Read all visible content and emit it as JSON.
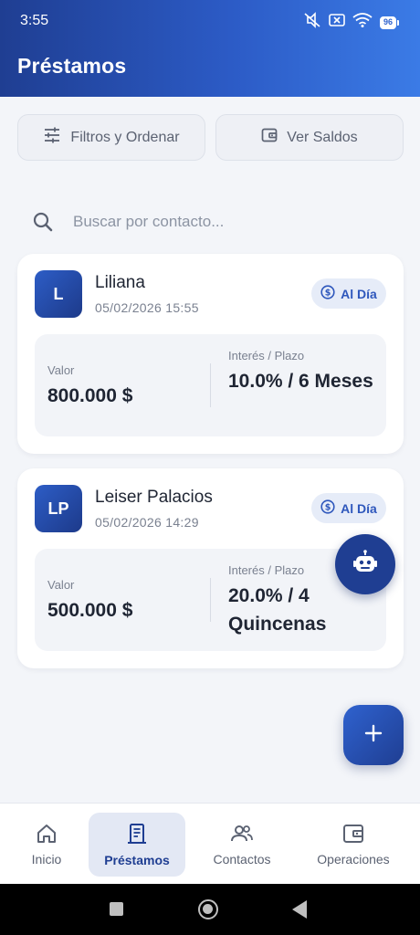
{
  "status_bar": {
    "time": "3:55",
    "battery": "96"
  },
  "header": {
    "title": "Préstamos"
  },
  "actions": {
    "filters_label": "Filtros y Ordenar",
    "balances_label": "Ver Saldos"
  },
  "search": {
    "placeholder": "Buscar por contacto..."
  },
  "loans": [
    {
      "initials": "L",
      "name": "Liliana",
      "datetime": "05/02/2026 15:55",
      "status": "Al Día",
      "valor_label": "Valor",
      "valor": "800.000 $",
      "interes_label": "Interés / Plazo",
      "interes": "10.0% / 6 Meses"
    },
    {
      "initials": "LP",
      "name": "Leiser Palacios",
      "datetime": "05/02/2026 14:29",
      "status": "Al Día",
      "valor_label": "Valor",
      "valor": "500.000 $",
      "interes_label": "Interés / Plazo",
      "interes": "20.0% / 4 Quincenas"
    }
  ],
  "nav": {
    "inicio": "Inicio",
    "prestamos": "Préstamos",
    "contactos": "Contactos",
    "operaciones": "Operaciones"
  },
  "colors": {
    "primary": "#1f3e92",
    "accent": "#3b7be6",
    "badge_bg": "#e6ecf8"
  },
  "icons": [
    "mute-icon",
    "sim-icon",
    "wifi-icon",
    "battery-icon",
    "sliders-icon",
    "wallet-icon",
    "search-icon",
    "dollar-circle-icon",
    "robot-icon",
    "plus-icon",
    "home-icon",
    "receipt-icon",
    "users-icon"
  ]
}
